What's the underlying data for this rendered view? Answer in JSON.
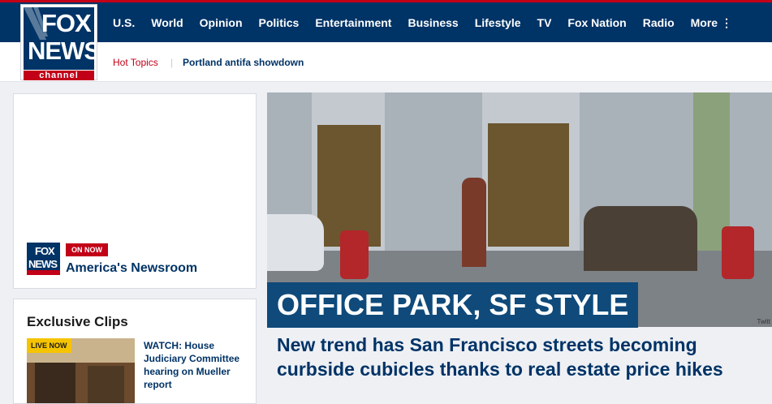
{
  "logo": {
    "line1": "FOX",
    "line2": "NEWS",
    "line3": "channel"
  },
  "nav": {
    "items": [
      "U.S.",
      "World",
      "Opinion",
      "Politics",
      "Entertainment",
      "Business",
      "Lifestyle",
      "TV",
      "Fox Nation",
      "Radio",
      "More ⋮"
    ]
  },
  "subnav": {
    "hot_label": "Hot Topics",
    "separator": "|",
    "topic": "Portland antifa showdown"
  },
  "live": {
    "logo_line1": "FOX",
    "logo_line2": "NEWS",
    "badge": "ON NOW",
    "show": "America's Newsroom"
  },
  "clips": {
    "title": "Exclusive Clips",
    "badge": "LIVE NOW",
    "item_text": "WATCH: House Judiciary Committee hearing on Mueller report"
  },
  "hero": {
    "label": "OFFICE PARK, SF STYLE",
    "headline": "New trend has San Francisco streets becoming curbside cubicles thanks to real estate price hikes",
    "credit": "Twitt"
  }
}
